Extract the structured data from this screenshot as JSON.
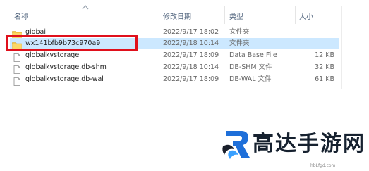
{
  "columns": {
    "name": "名称",
    "modified": "修改日期",
    "type": "类型",
    "size": "大小"
  },
  "files": [
    {
      "name": "global",
      "modified": "2022/9/17 18:02",
      "type": "文件夹",
      "size": "",
      "icon": "folder-icon",
      "selected": false
    },
    {
      "name": "wx141bfb9b73c970a9",
      "modified": "2022/9/18 10:14",
      "type": "文件夹",
      "size": "",
      "icon": "folder-icon",
      "selected": true
    },
    {
      "name": "globalkvstorage",
      "modified": "2022/9/17 18:09",
      "type": "Data Base File",
      "size": "12 KB",
      "icon": "file-icon",
      "selected": false
    },
    {
      "name": "globalkvstorage.db-shm",
      "modified": "2022/9/18 10:14",
      "type": "DB-SHM 文件",
      "size": "32 KB",
      "icon": "file-icon",
      "selected": false
    },
    {
      "name": "globalkvstorage.db-wal",
      "modified": "2022/9/17 18:09",
      "type": "DB-WAL 文件",
      "size": "61 KB",
      "icon": "file-icon",
      "selected": false
    }
  ],
  "watermark": {
    "brand": "高达手游网",
    "url": "hbLfgd.com"
  },
  "colors": {
    "selection": "#cce8ff",
    "highlight_border": "#e0101c",
    "folder": "#f7c948",
    "logo_blue": "#1e6fd9"
  }
}
